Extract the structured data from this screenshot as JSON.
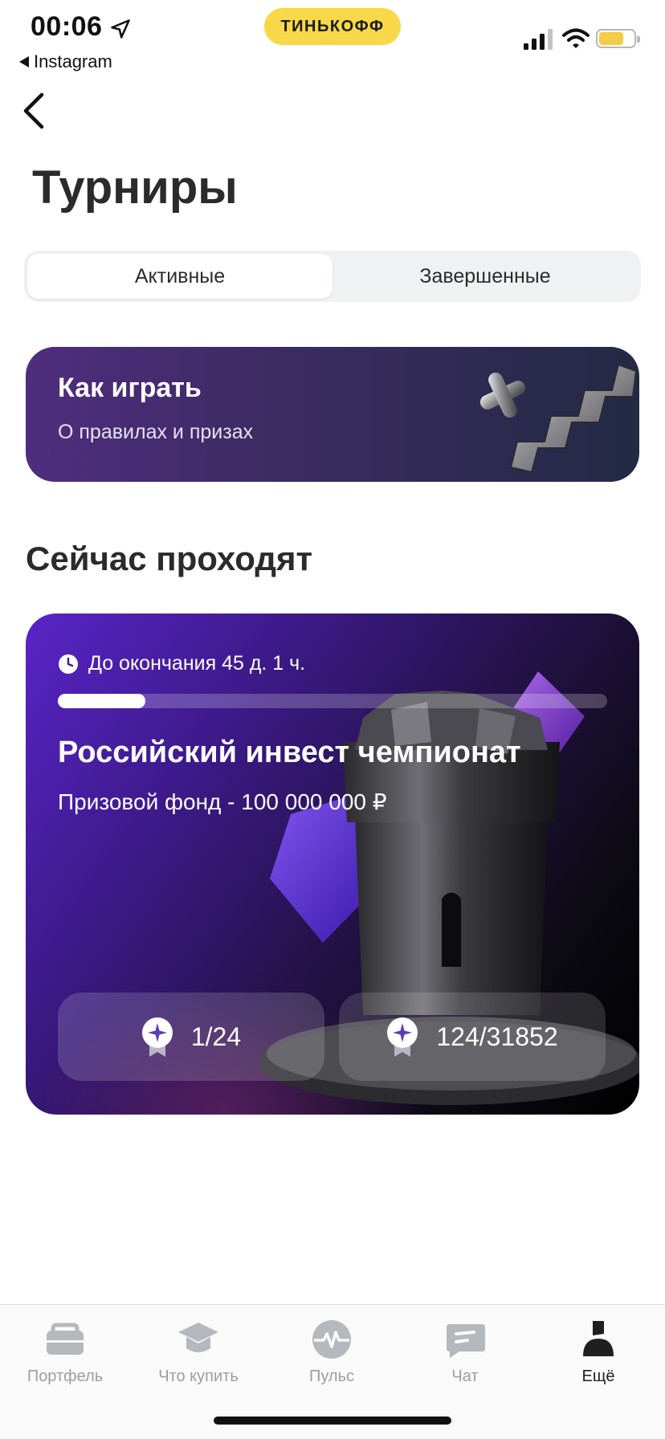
{
  "status_bar": {
    "time": "00:06",
    "back_app": "Instagram",
    "brand": "ТИНЬКОФФ",
    "battery_color": "#f4cc45"
  },
  "page": {
    "title": "Турниры"
  },
  "segment": {
    "tabs": [
      {
        "label": "Активные",
        "active": true
      },
      {
        "label": "Завершенные",
        "active": false
      }
    ]
  },
  "howto": {
    "title": "Как играть",
    "subtitle": "О правилах и призах"
  },
  "section": {
    "title": "Сейчас проходят"
  },
  "tournament": {
    "deadline": "До окончания 45 д. 1 ч.",
    "progress": 0.16,
    "title": "Российский инвест чемпионат",
    "prize": "Призовой фонд - 100 000 000 ₽",
    "stat_left": "1/24",
    "stat_right": "124/31852",
    "accent_color": "#5a24c8"
  },
  "tabbar": {
    "items": [
      {
        "label": "Портфель",
        "icon": "briefcase-icon",
        "active": false
      },
      {
        "label": "Что купить",
        "icon": "graduation-cap-icon",
        "active": false
      },
      {
        "label": "Пульс",
        "icon": "pulse-icon",
        "active": false
      },
      {
        "label": "Чат",
        "icon": "chat-icon",
        "active": false
      },
      {
        "label": "Ещё",
        "icon": "profile-icon",
        "active": true
      }
    ]
  }
}
